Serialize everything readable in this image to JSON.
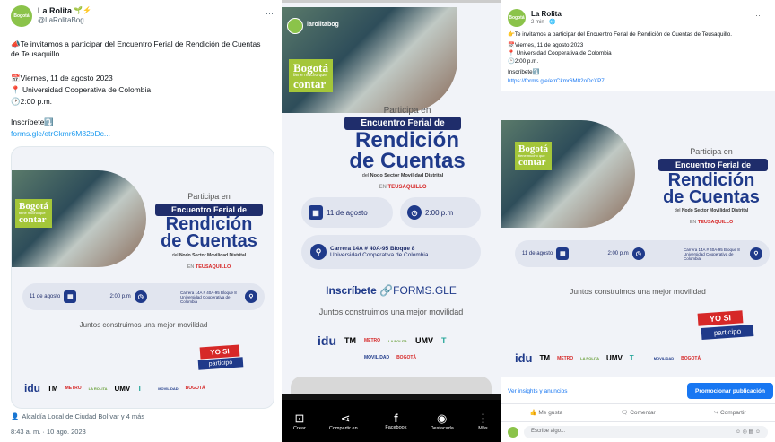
{
  "twitter": {
    "name": "La Rolita",
    "name_deco": "🌱⚡",
    "handle": "@LaRolitaBog",
    "more": "···",
    "avatar_text": "Bogotá",
    "text1": "📣Te invitamos a participar del Encuentro Ferial de Rendición de Cuentas de Teusaquillo.",
    "date": "📅Viernes, 11 de agosto 2023",
    "place": "📍 Universidad Cooperativa de Colombia",
    "time": "🕑2:00 p.m.",
    "inscribete": "Inscríbete⤵️",
    "link": "forms.gle/etrCkmr6M82oDc...",
    "tagged": "Alcaldía Local de Ciudad Bolívar y 4 más",
    "timestamp": "8:43 a. m. · 10 ago. 2023"
  },
  "poster": {
    "bogota": "Bogotá",
    "bogota_sub": "tiene mucho que",
    "contar": "contar",
    "participa": "Participa en",
    "encuentro": "Encuentro Ferial de",
    "rendicion": "Rendición",
    "de_cuentas": "de Cuentas",
    "nodo_pre": "del",
    "nodo": "Nodo Sector Movilidad Distrital",
    "en": "EN",
    "teusaquillo": "TEUSAQUILLO",
    "date": "11 de agosto",
    "time": "2:00 p.m",
    "address": "Carrera 14A # 40A-95 Bloque 8",
    "university": "Universidad Cooperativa de Colombia",
    "inscribete": "Inscríbete",
    "forms": "FORMS.GLE",
    "juntos": "Juntos construimos una mejor movilidad",
    "yosi": "YO SI",
    "participo": "participo",
    "logos": [
      "idu",
      "TM",
      "METRO",
      "LA ROLITA",
      "UMV",
      "T"
    ],
    "movilidad": "MOVILIDAD",
    "bogota_logo": "BOGOTÁ"
  },
  "story": {
    "account": "larolitabog",
    "actions": [
      {
        "icon": "create-icon",
        "glyph": "⊡",
        "label": "Crear"
      },
      {
        "icon": "share-icon",
        "glyph": "⋖",
        "label": "Compartir en..."
      },
      {
        "icon": "facebook-icon",
        "glyph": "f",
        "label": "Facebook"
      },
      {
        "icon": "highlight-icon",
        "glyph": "◉",
        "label": "Destacada"
      },
      {
        "icon": "more-icon",
        "glyph": "⋮",
        "label": "Más"
      }
    ]
  },
  "facebook": {
    "name": "La Rolita",
    "meta": "2 min · 🌐",
    "more": "···",
    "text1": "👉Te invitamos a participar del Encuentro Ferial de Rendición de Cuentas de Teusaquillo.",
    "date": "📅Viernes, 11 de agosto 2023",
    "place": "📍 Universidad Cooperativa de Colombia",
    "time": "🕑2:00 p.m.",
    "inscribete": "Inscríbete⤵️",
    "link": "https://forms.gle/etrCkmr6M82oDcXP7",
    "insights": "Ver insights y anuncios",
    "promote": "Promocionar publicación",
    "like": "Me gusta",
    "comment": "Comentar",
    "share": "Compartir",
    "comment_ph": "Escribe algo..."
  },
  "colors": {
    "navy": "#1f2d6b",
    "blue": "#1f3a8a",
    "green": "#a4c639",
    "red": "#d62828",
    "fb_blue": "#1877f2"
  }
}
